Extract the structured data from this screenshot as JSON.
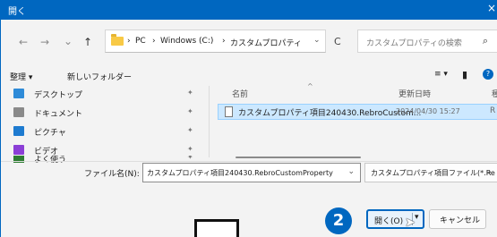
{
  "window": {
    "title": "開く",
    "close_glyph": "×"
  },
  "nav": {
    "back": "←",
    "forward": "→",
    "recent": "⌄",
    "up": "↑"
  },
  "address": {
    "sep": "›",
    "crumbs": [
      "PC",
      "Windows (C:)",
      "カスタムプロパティ"
    ],
    "dropdown": "⌄",
    "refresh": "C"
  },
  "search": {
    "placeholder": "カスタムプロパティの検索",
    "icon": "⌕"
  },
  "toolbar": {
    "organize": "整理 ▾",
    "new_folder": "新しいフォルダー",
    "view": "≡ ▾",
    "preview": "▮",
    "help": "?"
  },
  "sidebar": {
    "pin_glyph": "✦",
    "items": [
      {
        "label": "デスクトップ",
        "color": "#2e8bd8"
      },
      {
        "label": "ドキュメント",
        "color": "#8a8a8a"
      },
      {
        "label": "ピクチャ",
        "color": "#1e7bd0"
      },
      {
        "label": "ビデオ",
        "color": "#8b3fd6"
      },
      {
        "label": "よく使う",
        "color": "#2e7d32"
      }
    ]
  },
  "filelist": {
    "columns": {
      "name": "名前",
      "modified": "更新日時",
      "extra": "種"
    },
    "sort_glyph": "^",
    "rows": [
      {
        "name": "カスタムプロパティ項目240430.RebroCustom...",
        "modified": "2024/04/30 15:27",
        "extra": "R"
      }
    ]
  },
  "footer": {
    "filename_label": "ファイル名(N):",
    "filename_value": "カスタムプロパティ項目240430.RebroCustomProperty",
    "filename_dd": "⌄",
    "filetype": "カスタムプロパティ項目ファイル(*.Re",
    "filetype_dd": "⌄",
    "open": "開く(O)",
    "open_arrow": "▾",
    "cancel": "キャンセル"
  },
  "step": {
    "number": "2"
  },
  "colors": {
    "accent": "#0067c0",
    "selection": "#cce8ff"
  }
}
